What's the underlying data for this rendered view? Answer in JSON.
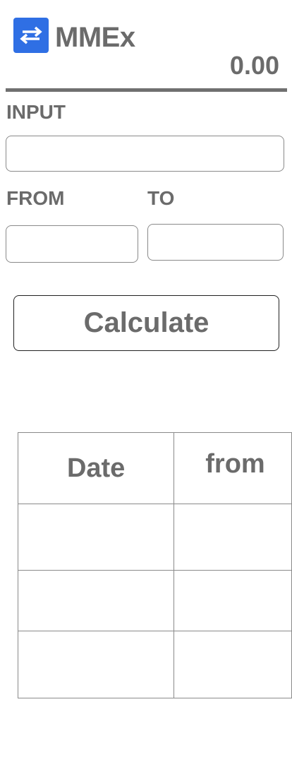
{
  "header": {
    "app_title": "MMEx",
    "logo_icon": "swap-arrows-icon",
    "result_value": "0.00"
  },
  "form": {
    "input_label": "INPUT",
    "input_value": "",
    "from_label": "FROM",
    "from_value": "",
    "to_label": "TO",
    "to_value": "",
    "calculate_label": "Calculate"
  },
  "history": {
    "columns": [
      "Date",
      "from"
    ],
    "rows": [
      [
        "",
        ""
      ],
      [
        "",
        ""
      ],
      [
        "",
        ""
      ]
    ]
  },
  "colors": {
    "accent": "#2f6fe4",
    "text": "#6b6b6b"
  }
}
